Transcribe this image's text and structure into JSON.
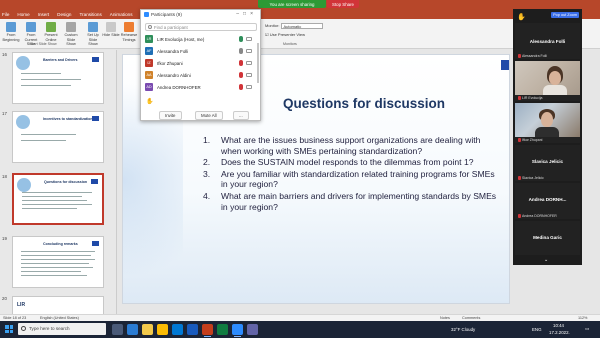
{
  "ribbon": {
    "tabs": [
      "File",
      "Home",
      "Insert",
      "Design",
      "Transitions",
      "Animations",
      "Slide Show"
    ],
    "active_tab": "Slide Show",
    "buttons": [
      "From Beginning",
      "From Current Slide",
      "Present Online",
      "Custom Slide Show",
      "Set Up Slide Show",
      "Hide Slide",
      "Rehearse Timings",
      "Record"
    ],
    "group_label_start": "Start Slide Show",
    "group_label_monitors": "Monitors",
    "monitor_label": "Monitor:",
    "monitor_value": "Automatic",
    "presenter_view_label": "Use Presenter View"
  },
  "share": {
    "status": "You are screen sharing",
    "stop_label": "Stop Share"
  },
  "thumbnails": [
    {
      "num": "16",
      "title": "Barriers and Drivers"
    },
    {
      "num": "17",
      "title": "Incentives to standardization"
    },
    {
      "num": "18",
      "title": "Questions for discussion"
    },
    {
      "num": "19",
      "title": "Concluding remarks"
    },
    {
      "num": "20",
      "title": ""
    }
  ],
  "slide": {
    "title": "Questions for discussion",
    "items": [
      {
        "num": "1.",
        "lines": [
          "What are the issues business support organizations are dealing with",
          "when working with SMEs pertaining standardization?"
        ]
      },
      {
        "num": "2.",
        "lines": [
          "Does the SUSTAIN model responds to the dilemmas from point 1?"
        ]
      },
      {
        "num": "3.",
        "lines": [
          "Are you familiar with standardization related training programs for SMEs",
          "in your region?"
        ]
      },
      {
        "num": "4.",
        "lines": [
          "What are main barriers and drivers for implementing standards by SMEs",
          "in your region?"
        ]
      }
    ],
    "page_number": "18"
  },
  "participants": {
    "title": "Participants (9)",
    "search_placeholder": "Find a participant",
    "list": [
      {
        "initials": "LR",
        "name": "LIR Evolucija (Host, me)",
        "color": "#2f8f5b"
      },
      {
        "initials": "AF",
        "name": "Alessandra Folli",
        "color": "#1f6fb5"
      },
      {
        "initials": "IZ",
        "name": "Ifkor Zhupani",
        "color": "#c0392b"
      },
      {
        "initials": "AA",
        "name": "Alessandro Aldini",
        "color": "#d0822a"
      },
      {
        "initials": "AD",
        "name": "Andrea DORNHOFER",
        "color": "#7a4bb0"
      }
    ],
    "invite_label": "Invite",
    "mute_all_label": "Mute All",
    "more_label": "..."
  },
  "video": {
    "popout_label": "Pop out Zoom",
    "tiles": [
      {
        "name": "Alessandra Folli",
        "sub": "Alessandra Folli"
      },
      {
        "name": "",
        "sub": "LIR Evolucija"
      },
      {
        "name": "",
        "sub": "Ifkor Zhupani"
      },
      {
        "name": "Slavica Jelicic",
        "sub": "Slavica Jelicic"
      },
      {
        "name": "Andrea DORNH...",
        "sub": "Andrea DORNHOFER"
      },
      {
        "name": "Medina Garic",
        "sub": ""
      }
    ]
  },
  "statusbar": {
    "slide_info": "Slide 18 of 23",
    "language": "English (United States)",
    "notes": "Notes",
    "comments": "Comments",
    "zoom": "112%"
  },
  "taskbar": {
    "search_placeholder": "Type here to search",
    "weather": "32°F Cloudy",
    "lang": "ENG",
    "time": "10:44",
    "date": "17.2.2022."
  }
}
